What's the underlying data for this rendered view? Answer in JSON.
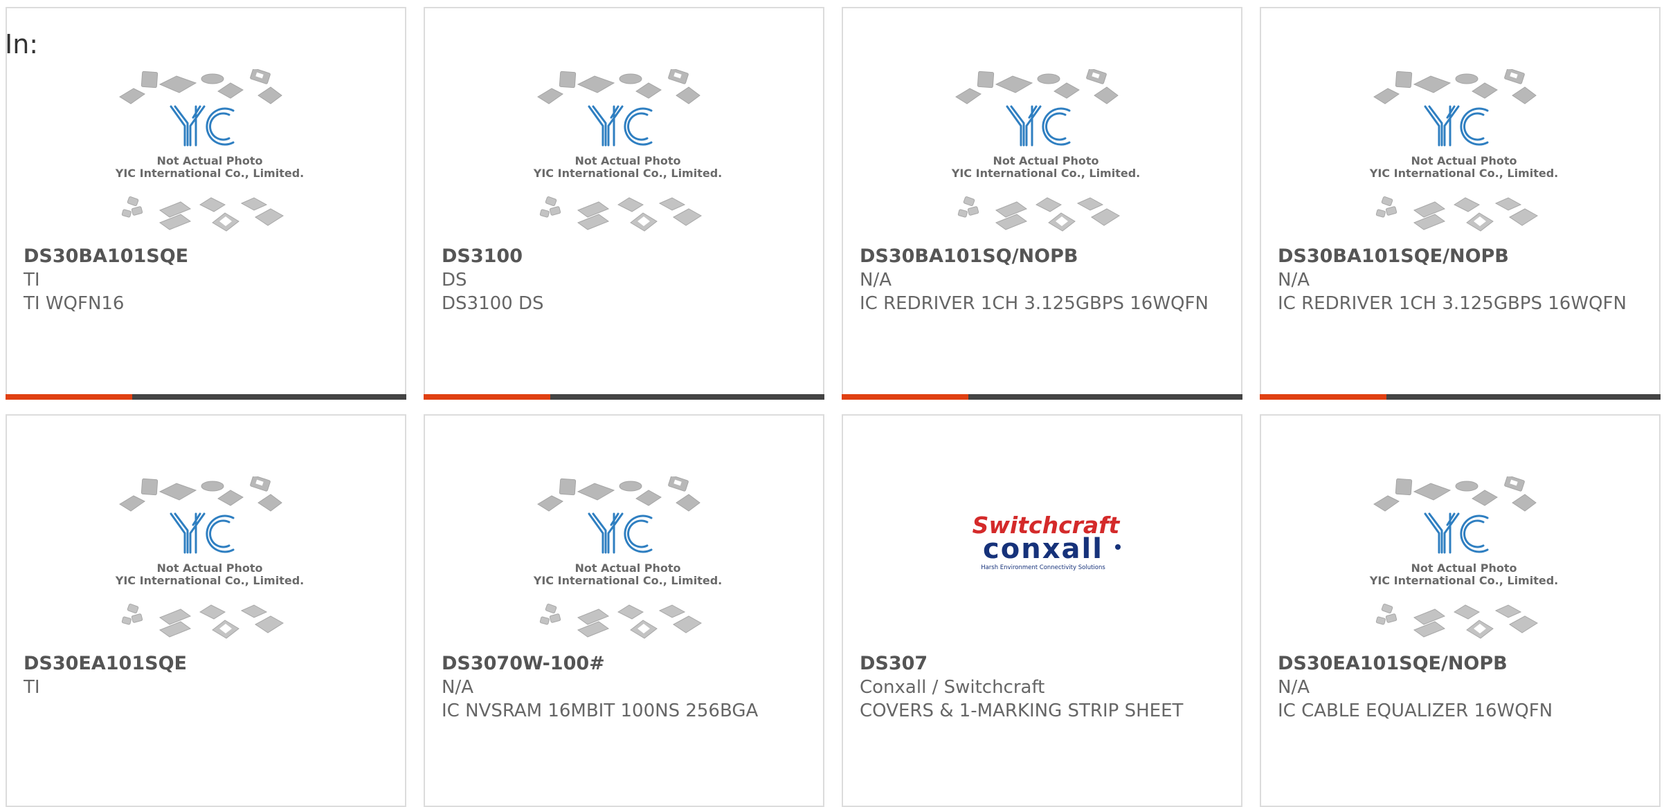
{
  "header": {
    "label": "In:"
  },
  "colors": {
    "accent": "#e04012",
    "bar": "#444444",
    "logo_blue": "#2f7fc1",
    "switchcraft_red": "#d42a2a",
    "conxall_blue": "#16327a"
  },
  "placeholder": {
    "line1": "Not Actual Photo",
    "line2": "YIC International Co., Limited."
  },
  "switchcraft_logo": {
    "brand": "Switchcraft",
    "sub": "conxall",
    "tagline": "Harsh Environment Connectivity Solutions"
  },
  "products": [
    {
      "name": "DS30BA101SQE",
      "brand": "TI",
      "desc": "TI WQFN16",
      "image": "yic-placeholder",
      "has_bar": true
    },
    {
      "name": "DS3100",
      "brand": "DS",
      "desc": "DS3100 DS",
      "image": "yic-placeholder",
      "has_bar": true
    },
    {
      "name": "DS30BA101SQ/NOPB",
      "brand": "N/A",
      "desc": "IC REDRIVER 1CH 3.125GBPS 16WQFN",
      "image": "yic-placeholder",
      "has_bar": true
    },
    {
      "name": "DS30BA101SQE/NOPB",
      "brand": "N/A",
      "desc": "IC REDRIVER 1CH 3.125GBPS 16WQFN",
      "image": "yic-placeholder",
      "has_bar": true
    },
    {
      "name": "DS30EA101SQE",
      "brand": "TI",
      "desc": "",
      "image": "yic-placeholder",
      "has_bar": false
    },
    {
      "name": "DS3070W-100#",
      "brand": "N/A",
      "desc": "IC NVSRAM 16MBIT 100NS 256BGA",
      "image": "yic-placeholder",
      "has_bar": false
    },
    {
      "name": "DS307",
      "brand": "Conxall / Switchcraft",
      "desc": "COVERS & 1-MARKING STRIP SHEET",
      "image": "switchcraft-logo",
      "has_bar": false
    },
    {
      "name": "DS30EA101SQE/NOPB",
      "brand": "N/A",
      "desc": "IC CABLE EQUALIZER 16WQFN",
      "image": "yic-placeholder",
      "has_bar": false
    }
  ]
}
